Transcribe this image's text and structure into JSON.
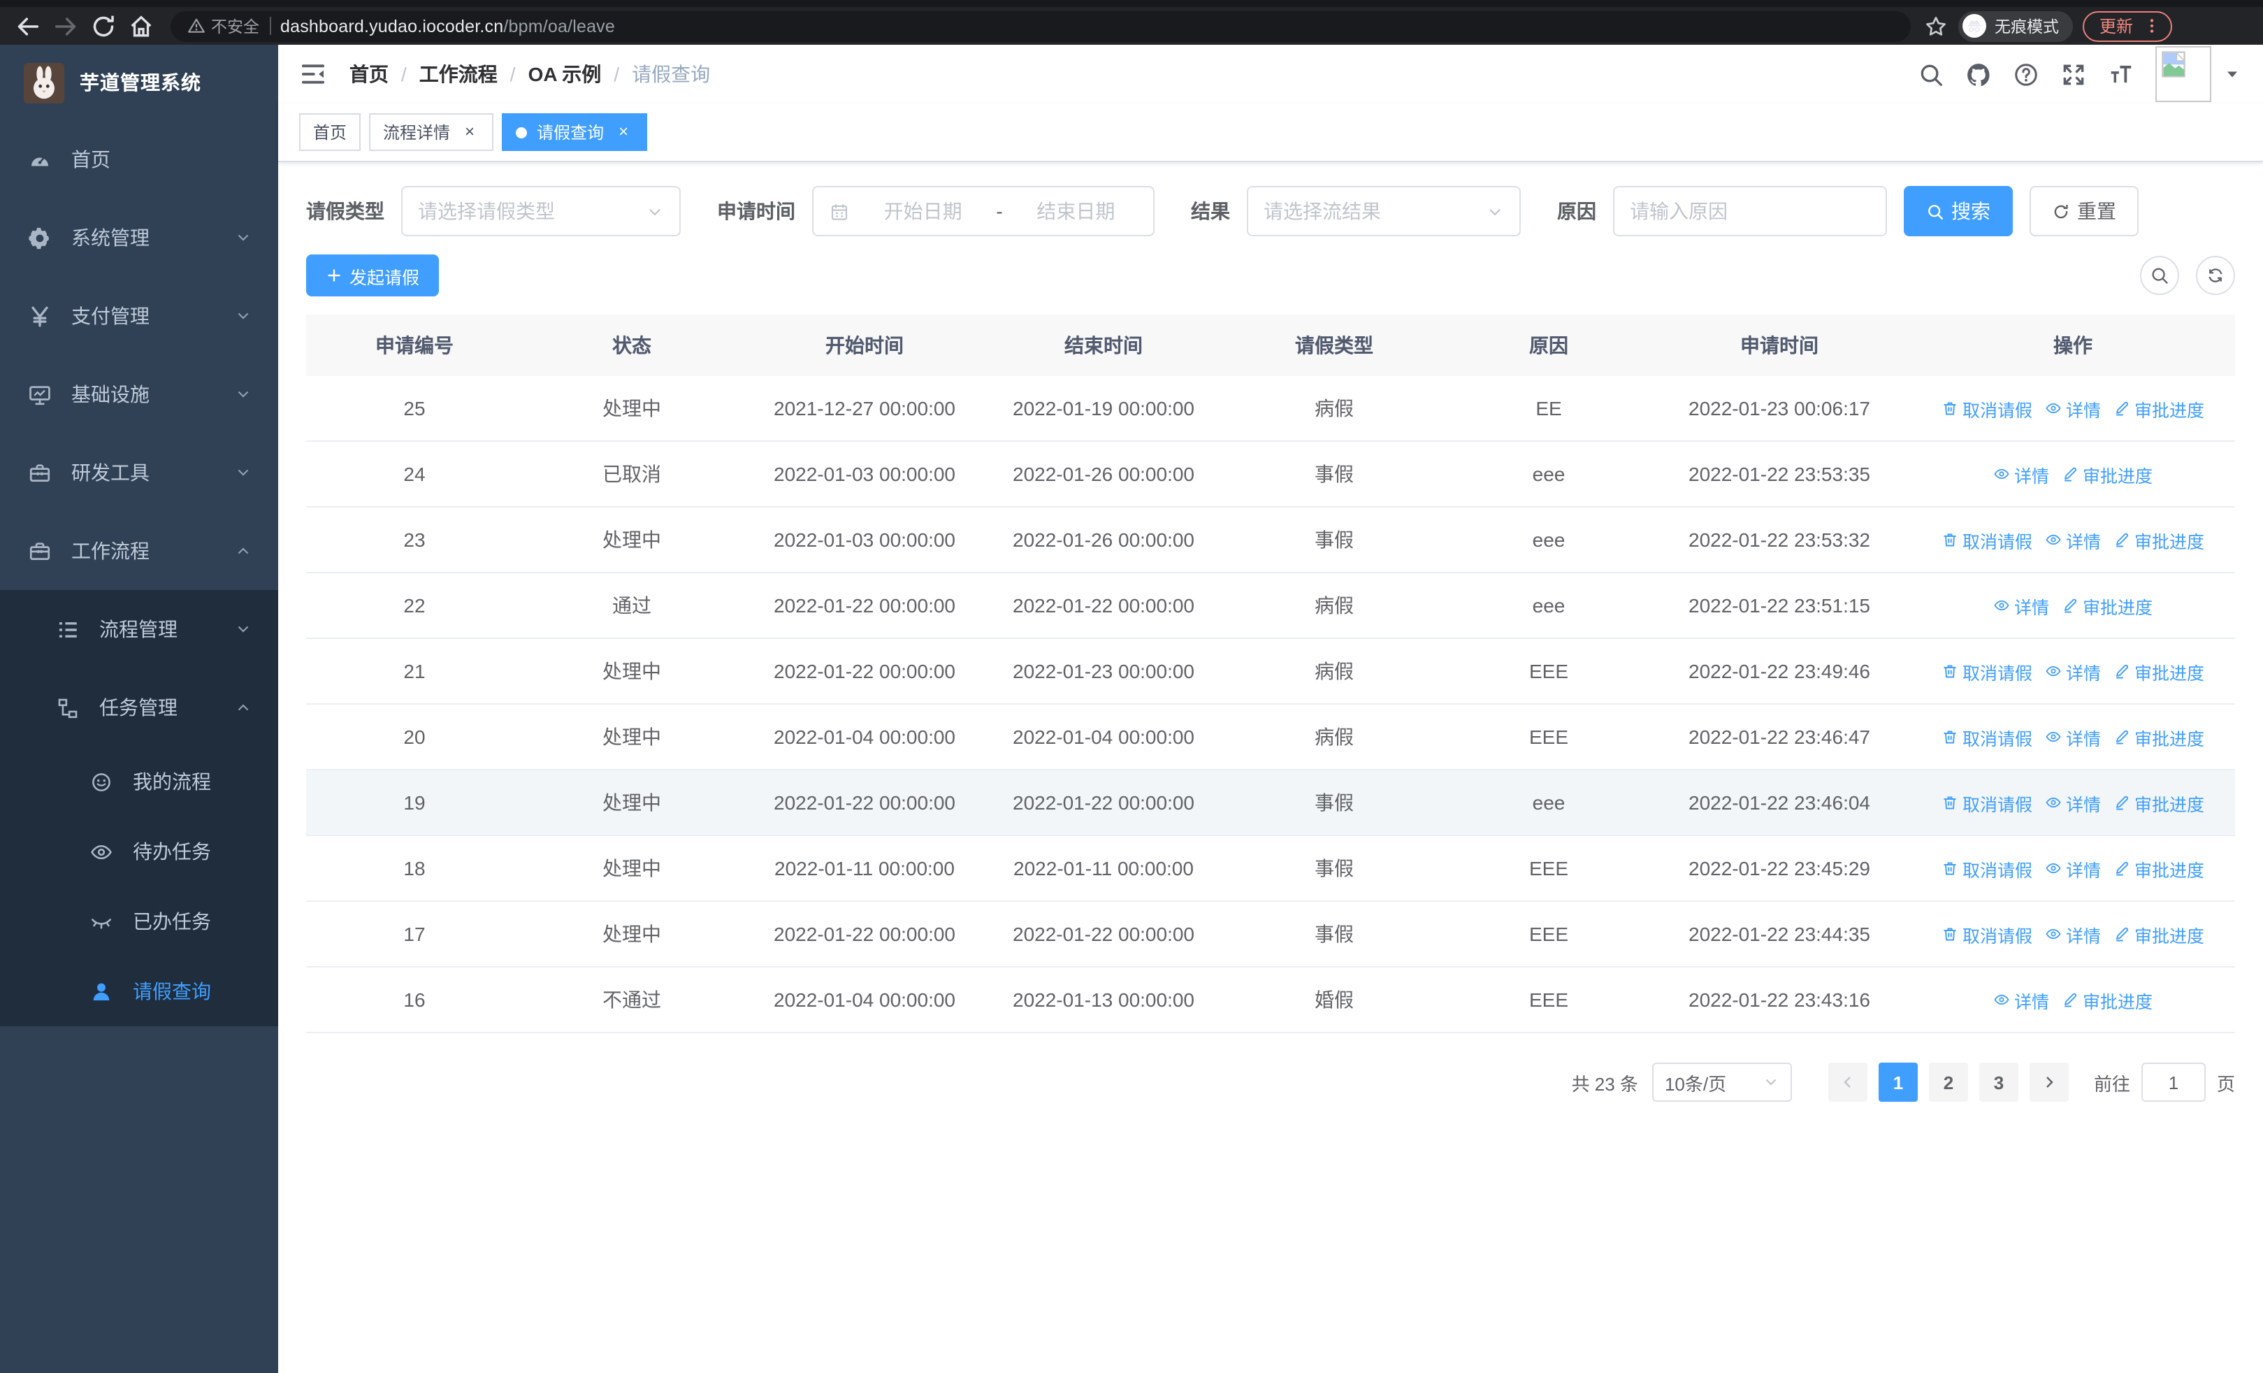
{
  "browser": {
    "security_label": "不安全",
    "url_domain": "dashboard.yudao.iocoder.cn",
    "url_path": "/bpm/oa/leave",
    "incognito_label": "无痕模式",
    "update_label": "更新"
  },
  "sidebar": {
    "logo_title": "芋道管理系统",
    "items": [
      {
        "icon": "dashboard",
        "label": "首页",
        "level": 1
      },
      {
        "icon": "gear",
        "label": "系统管理",
        "level": 1,
        "chevron": "down"
      },
      {
        "icon": "yen",
        "label": "支付管理",
        "level": 1,
        "chevron": "down"
      },
      {
        "icon": "monitor",
        "label": "基础设施",
        "level": 1,
        "chevron": "down"
      },
      {
        "icon": "toolbox",
        "label": "研发工具",
        "level": 1,
        "chevron": "down"
      },
      {
        "icon": "briefcase",
        "label": "工作流程",
        "level": 1,
        "chevron": "up"
      },
      {
        "icon": "list",
        "label": "流程管理",
        "level": 2,
        "chevron": "down"
      },
      {
        "icon": "tree",
        "label": "任务管理",
        "level": 2,
        "chevron": "up"
      },
      {
        "icon": "robot",
        "label": "我的流程",
        "level": 3
      },
      {
        "icon": "eye",
        "label": "待办任务",
        "level": 3
      },
      {
        "icon": "eye-closed",
        "label": "已办任务",
        "level": 3
      },
      {
        "icon": "user",
        "label": "请假查询",
        "level": 3,
        "active": true
      }
    ]
  },
  "breadcrumb": {
    "items": [
      "首页",
      "工作流程",
      "OA 示例",
      "请假查询"
    ],
    "separator": "/"
  },
  "tabs": [
    {
      "label": "首页",
      "closable": false,
      "active": false
    },
    {
      "label": "流程详情",
      "closable": true,
      "active": false
    },
    {
      "label": "请假查询",
      "closable": true,
      "active": true
    }
  ],
  "filters": {
    "leave_type_label": "请假类型",
    "leave_type_placeholder": "请选择请假类型",
    "apply_time_label": "申请时间",
    "start_date_placeholder": "开始日期",
    "range_separator": "-",
    "end_date_placeholder": "结束日期",
    "result_label": "结果",
    "result_placeholder": "请选择流结果",
    "reason_label": "原因",
    "reason_placeholder": "请输入原因",
    "search_button": "搜索",
    "reset_button": "重置"
  },
  "toolbar": {
    "create_button": "发起请假"
  },
  "table": {
    "columns": [
      "申请编号",
      "状态",
      "开始时间",
      "结束时间",
      "请假类型",
      "原因",
      "申请时间",
      "操作"
    ],
    "rows": [
      {
        "id": "25",
        "status": "处理中",
        "start": "2021-12-27 00:00:00",
        "end": "2022-01-19 00:00:00",
        "type": "病假",
        "reason": "EE",
        "applied": "2022-01-23 00:06:17",
        "actions": [
          {
            "icon": "trash",
            "label": "取消请假"
          },
          {
            "icon": "eye",
            "label": "详情"
          },
          {
            "icon": "edit",
            "label": "审批进度"
          }
        ]
      },
      {
        "id": "24",
        "status": "已取消",
        "start": "2022-01-03 00:00:00",
        "end": "2022-01-26 00:00:00",
        "type": "事假",
        "reason": "eee",
        "applied": "2022-01-22 23:53:35",
        "actions": [
          {
            "icon": "eye",
            "label": "详情"
          },
          {
            "icon": "edit",
            "label": "审批进度"
          }
        ]
      },
      {
        "id": "23",
        "status": "处理中",
        "start": "2022-01-03 00:00:00",
        "end": "2022-01-26 00:00:00",
        "type": "事假",
        "reason": "eee",
        "applied": "2022-01-22 23:53:32",
        "actions": [
          {
            "icon": "trash",
            "label": "取消请假"
          },
          {
            "icon": "eye",
            "label": "详情"
          },
          {
            "icon": "edit",
            "label": "审批进度"
          }
        ]
      },
      {
        "id": "22",
        "status": "通过",
        "start": "2022-01-22 00:00:00",
        "end": "2022-01-22 00:00:00",
        "type": "病假",
        "reason": "eee",
        "applied": "2022-01-22 23:51:15",
        "actions": [
          {
            "icon": "eye",
            "label": "详情"
          },
          {
            "icon": "edit",
            "label": "审批进度"
          }
        ]
      },
      {
        "id": "21",
        "status": "处理中",
        "start": "2022-01-22 00:00:00",
        "end": "2022-01-23 00:00:00",
        "type": "病假",
        "reason": "EEE",
        "applied": "2022-01-22 23:49:46",
        "actions": [
          {
            "icon": "trash",
            "label": "取消请假"
          },
          {
            "icon": "eye",
            "label": "详情"
          },
          {
            "icon": "edit",
            "label": "审批进度"
          }
        ]
      },
      {
        "id": "20",
        "status": "处理中",
        "start": "2022-01-04 00:00:00",
        "end": "2022-01-04 00:00:00",
        "type": "病假",
        "reason": "EEE",
        "applied": "2022-01-22 23:46:47",
        "actions": [
          {
            "icon": "trash",
            "label": "取消请假"
          },
          {
            "icon": "eye",
            "label": "详情"
          },
          {
            "icon": "edit",
            "label": "审批进度"
          }
        ]
      },
      {
        "id": "19",
        "status": "处理中",
        "start": "2022-01-22 00:00:00",
        "end": "2022-01-22 00:00:00",
        "type": "事假",
        "reason": "eee",
        "applied": "2022-01-22 23:46:04",
        "highlighted": true,
        "actions": [
          {
            "icon": "trash",
            "label": "取消请假"
          },
          {
            "icon": "eye",
            "label": "详情"
          },
          {
            "icon": "edit",
            "label": "审批进度"
          }
        ]
      },
      {
        "id": "18",
        "status": "处理中",
        "start": "2022-01-11 00:00:00",
        "end": "2022-01-11 00:00:00",
        "type": "事假",
        "reason": "EEE",
        "applied": "2022-01-22 23:45:29",
        "actions": [
          {
            "icon": "trash",
            "label": "取消请假"
          },
          {
            "icon": "eye",
            "label": "详情"
          },
          {
            "icon": "edit",
            "label": "审批进度"
          }
        ]
      },
      {
        "id": "17",
        "status": "处理中",
        "start": "2022-01-22 00:00:00",
        "end": "2022-01-22 00:00:00",
        "type": "事假",
        "reason": "EEE",
        "applied": "2022-01-22 23:44:35",
        "actions": [
          {
            "icon": "trash",
            "label": "取消请假"
          },
          {
            "icon": "eye",
            "label": "详情"
          },
          {
            "icon": "edit",
            "label": "审批进度"
          }
        ]
      },
      {
        "id": "16",
        "status": "不通过",
        "start": "2022-01-04 00:00:00",
        "end": "2022-01-13 00:00:00",
        "type": "婚假",
        "reason": "EEE",
        "applied": "2022-01-22 23:43:16",
        "actions": [
          {
            "icon": "eye",
            "label": "详情"
          },
          {
            "icon": "edit",
            "label": "审批进度"
          }
        ]
      }
    ]
  },
  "pagination": {
    "total": "共 23 条",
    "page_size": "10条/页",
    "pages": [
      "1",
      "2",
      "3"
    ],
    "active_page": "1",
    "jump_prefix": "前往",
    "jump_value": "1",
    "jump_suffix": "页"
  },
  "colors": {
    "accent": "#409eff",
    "sidebar_bg": "#304156",
    "submenu_bg": "#1f2d3d",
    "sidebar_text": "#bfcbd9",
    "link": "#409eff",
    "update_chip": "#ef877e",
    "table_header_bg": "#f8f8f9"
  }
}
